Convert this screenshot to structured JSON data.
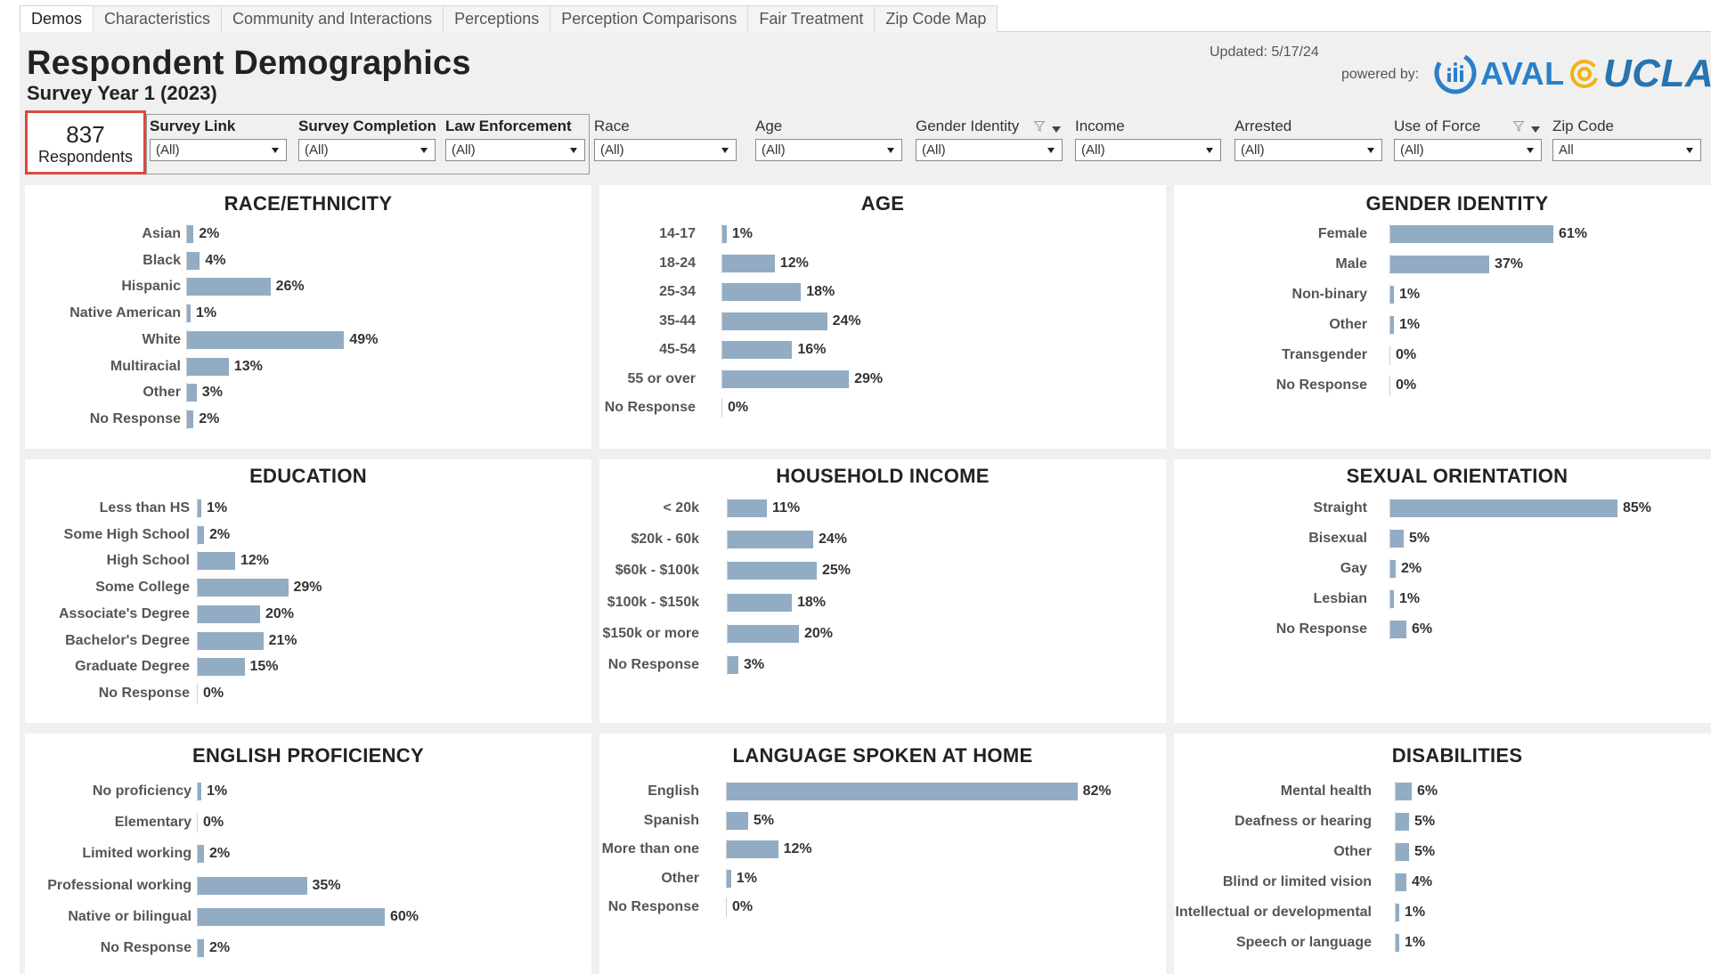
{
  "tabs": [
    "Demos",
    "Characteristics",
    "Community and Interactions",
    "Perceptions",
    "Perception Comparisons",
    "Fair Treatment",
    "Zip Code Map"
  ],
  "header": {
    "title": "Respondent Demographics",
    "subtitle": "Survey Year 1 (2023)",
    "updated": "Updated: 5/17/24",
    "powered_by": "powered by:",
    "aval": "AVAL",
    "ucla": "UCLA"
  },
  "respondents": {
    "count": "837",
    "label": "Respondents"
  },
  "filters": [
    {
      "label": "Survey Link",
      "value": "(All)",
      "bold": true
    },
    {
      "label": "Survey Completion",
      "value": "(All)",
      "bold": true
    },
    {
      "label": "Law Enforcement",
      "value": "(All)",
      "bold": true
    },
    {
      "label": "Race",
      "value": "(All)"
    },
    {
      "label": "Age",
      "value": "(All)"
    },
    {
      "label": "Gender Identity",
      "value": "(All)",
      "funnel": true
    },
    {
      "label": "Income",
      "value": "(All)"
    },
    {
      "label": "Arrested",
      "value": "(All)"
    },
    {
      "label": "Use of Force",
      "value": "(All)",
      "funnel": true
    },
    {
      "label": "Zip Code",
      "value": "All"
    }
  ],
  "colors": {
    "bar": "#92acc4",
    "highlight": "#e0483e",
    "aval_blue": "#2a7fc9",
    "ucla_blue": "#2774ae",
    "ucla_gold": "#f2b318"
  },
  "chart_data": [
    {
      "type": "bar",
      "title": "RACE/ETHNICITY",
      "categories": [
        "Asian",
        "Black",
        "Hispanic",
        "Native American",
        "White",
        "Multiracial",
        "Other",
        "No Response"
      ],
      "values": [
        2,
        4,
        26,
        1,
        49,
        13,
        3,
        2
      ],
      "labels": [
        "2%",
        "4%",
        "26%",
        "1%",
        "49%",
        "13%",
        "3%",
        "2%"
      ]
    },
    {
      "type": "bar",
      "title": "AGE",
      "categories": [
        "14-17",
        "18-24",
        "25-34",
        "35-44",
        "45-54",
        "55 or over",
        "No Response"
      ],
      "values": [
        1,
        12,
        18,
        24,
        16,
        29,
        0
      ],
      "labels": [
        "1%",
        "12%",
        "18%",
        "24%",
        "16%",
        "29%",
        "0%"
      ]
    },
    {
      "type": "bar",
      "title": "GENDER IDENTITY",
      "categories": [
        "Female",
        "Male",
        "Non-binary",
        "Other",
        "Transgender",
        "No Response"
      ],
      "values": [
        61,
        37,
        1,
        1,
        0,
        0
      ],
      "labels": [
        "61%",
        "37%",
        "1%",
        "1%",
        "0%",
        "0%"
      ]
    },
    {
      "type": "bar",
      "title": "EDUCATION",
      "categories": [
        "Less than HS",
        "Some High School",
        "High School",
        "Some College",
        "Associate's Degree",
        "Bachelor's Degree",
        "Graduate Degree",
        "No Response"
      ],
      "values": [
        1,
        2,
        12,
        29,
        20,
        21,
        15,
        0
      ],
      "labels": [
        "1%",
        "2%",
        "12%",
        "29%",
        "20%",
        "21%",
        "15%",
        "0%"
      ]
    },
    {
      "type": "bar",
      "title": "HOUSEHOLD INCOME",
      "categories": [
        "< 20k",
        "$20k - 60k",
        "$60k - $100k",
        "$100k - $150k",
        "$150k or more",
        "No Response"
      ],
      "values": [
        11,
        24,
        25,
        18,
        20,
        3
      ],
      "labels": [
        "11%",
        "24%",
        "25%",
        "18%",
        "20%",
        "3%"
      ]
    },
    {
      "type": "bar",
      "title": "SEXUAL ORIENTATION",
      "categories": [
        "Straight",
        "Bisexual",
        "Gay",
        "Lesbian",
        "No Response"
      ],
      "values": [
        85,
        5,
        2,
        1,
        6
      ],
      "labels": [
        "85%",
        "5%",
        "2%",
        "1%",
        "6%"
      ]
    },
    {
      "type": "bar",
      "title": "ENGLISH PROFICIENCY",
      "categories": [
        "No proficiency",
        "Elementary",
        "Limited working",
        "Professional working",
        "Native or bilingual",
        "No Response"
      ],
      "values": [
        1,
        0,
        2,
        35,
        60,
        2
      ],
      "labels": [
        "1%",
        "0%",
        "2%",
        "35%",
        "60%",
        "2%"
      ]
    },
    {
      "type": "bar",
      "title": "LANGUAGE SPOKEN AT HOME",
      "categories": [
        "English",
        "Spanish",
        "More than one",
        "Other",
        "No Response"
      ],
      "values": [
        82,
        5,
        12,
        1,
        0
      ],
      "labels": [
        "82%",
        "5%",
        "12%",
        "1%",
        "0%"
      ]
    },
    {
      "type": "bar",
      "title": "DISABILITIES",
      "categories": [
        "Mental health",
        "Deafness or hearing",
        "Other",
        "Blind or limited vision",
        "Intellectual or developmental",
        "Speech or language"
      ],
      "values": [
        6,
        5,
        5,
        4,
        1,
        1
      ],
      "labels": [
        "6%",
        "5%",
        "5%",
        "4%",
        "1%",
        "1%"
      ]
    }
  ]
}
